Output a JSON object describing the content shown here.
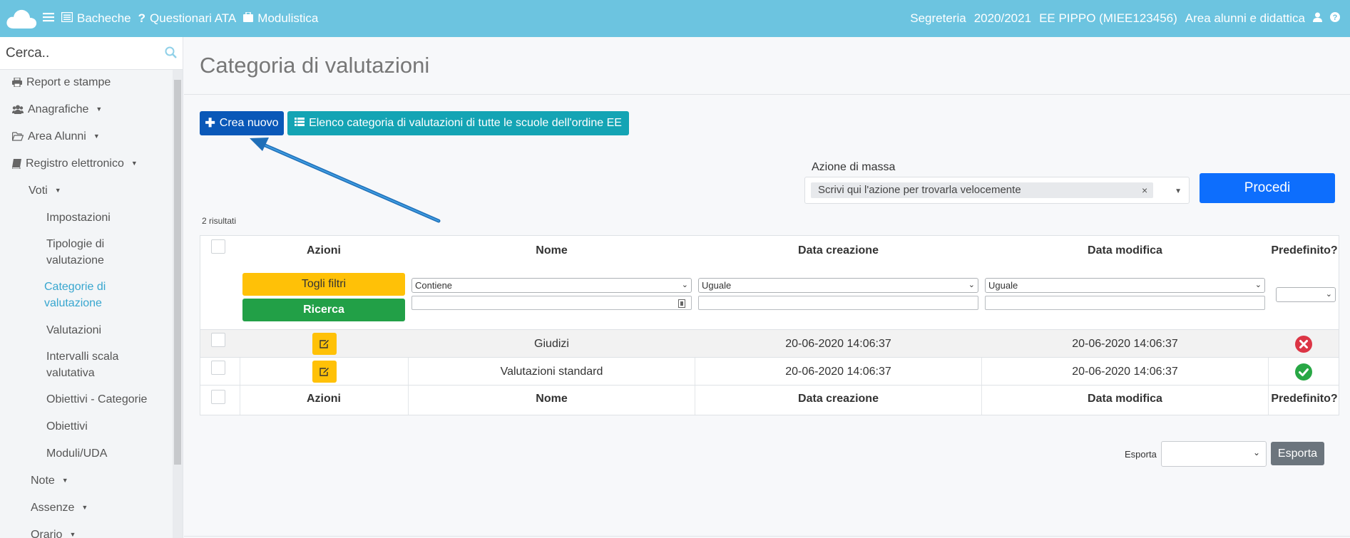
{
  "topbar": {
    "nav": [
      {
        "label": "Bacheche",
        "icon": "list-icon"
      },
      {
        "label": "Questionari ATA",
        "icon": "question-icon"
      },
      {
        "label": "Modulistica",
        "icon": "briefcase-icon"
      }
    ],
    "right": {
      "role": "Segreteria",
      "year": "2020/2021",
      "school": "EE PIPPO (MIEE123456)",
      "area": "Area alunni e didattica"
    },
    "colors": {
      "bar": "#6cc4e0"
    }
  },
  "sidebar": {
    "search_placeholder": "Cerca..",
    "items": [
      {
        "label": "Report e stampe"
      },
      {
        "label": "Anagrafiche"
      },
      {
        "label": "Area Alunni"
      },
      {
        "label": "Registro elettronico"
      },
      {
        "label": "Voti"
      },
      {
        "label": "Impostazioni"
      },
      {
        "label": "Tipologie di valutazione"
      },
      {
        "label": "Categorie di valutazione",
        "active": true
      },
      {
        "label": "Valutazioni"
      },
      {
        "label": "Intervalli scala valutativa"
      },
      {
        "label": "Obiettivi - Categorie"
      },
      {
        "label": "Obiettivi"
      },
      {
        "label": "Moduli/UDA"
      },
      {
        "label": "Note"
      },
      {
        "label": "Assenze"
      },
      {
        "label": "Orario"
      }
    ]
  },
  "main": {
    "title": "Categoria di valutazioni",
    "create_button": "Crea nuovo",
    "list_button": "Elenco categoria di valutazioni di tutte le scuole dell'ordine EE",
    "mass_action": {
      "label": "Azione di massa",
      "placeholder": "Scrivi qui l'azione per trovarla velocemente",
      "clear": "×",
      "proceed": "Procedi"
    },
    "results_count": "2 risultati",
    "table": {
      "columns": [
        "Azioni",
        "Nome",
        "Data creazione",
        "Data modifica",
        "Predefinito?"
      ],
      "filters": {
        "clear": "Togli filtri",
        "search": "Ricerca",
        "nome_mode": "Contiene",
        "creazione_mode": "Uguale",
        "modifica_mode": "Uguale"
      },
      "rows": [
        {
          "nome": "Giudizi",
          "creazione": "20-06-2020 14:06:37",
          "modifica": "20-06-2020 14:06:37",
          "predefinito": false
        },
        {
          "nome": "Valutazioni standard",
          "creazione": "20-06-2020 14:06:37",
          "modifica": "20-06-2020 14:06:37",
          "predefinito": true
        }
      ]
    },
    "export": {
      "label": "Esporta",
      "button": "Esporta"
    }
  }
}
